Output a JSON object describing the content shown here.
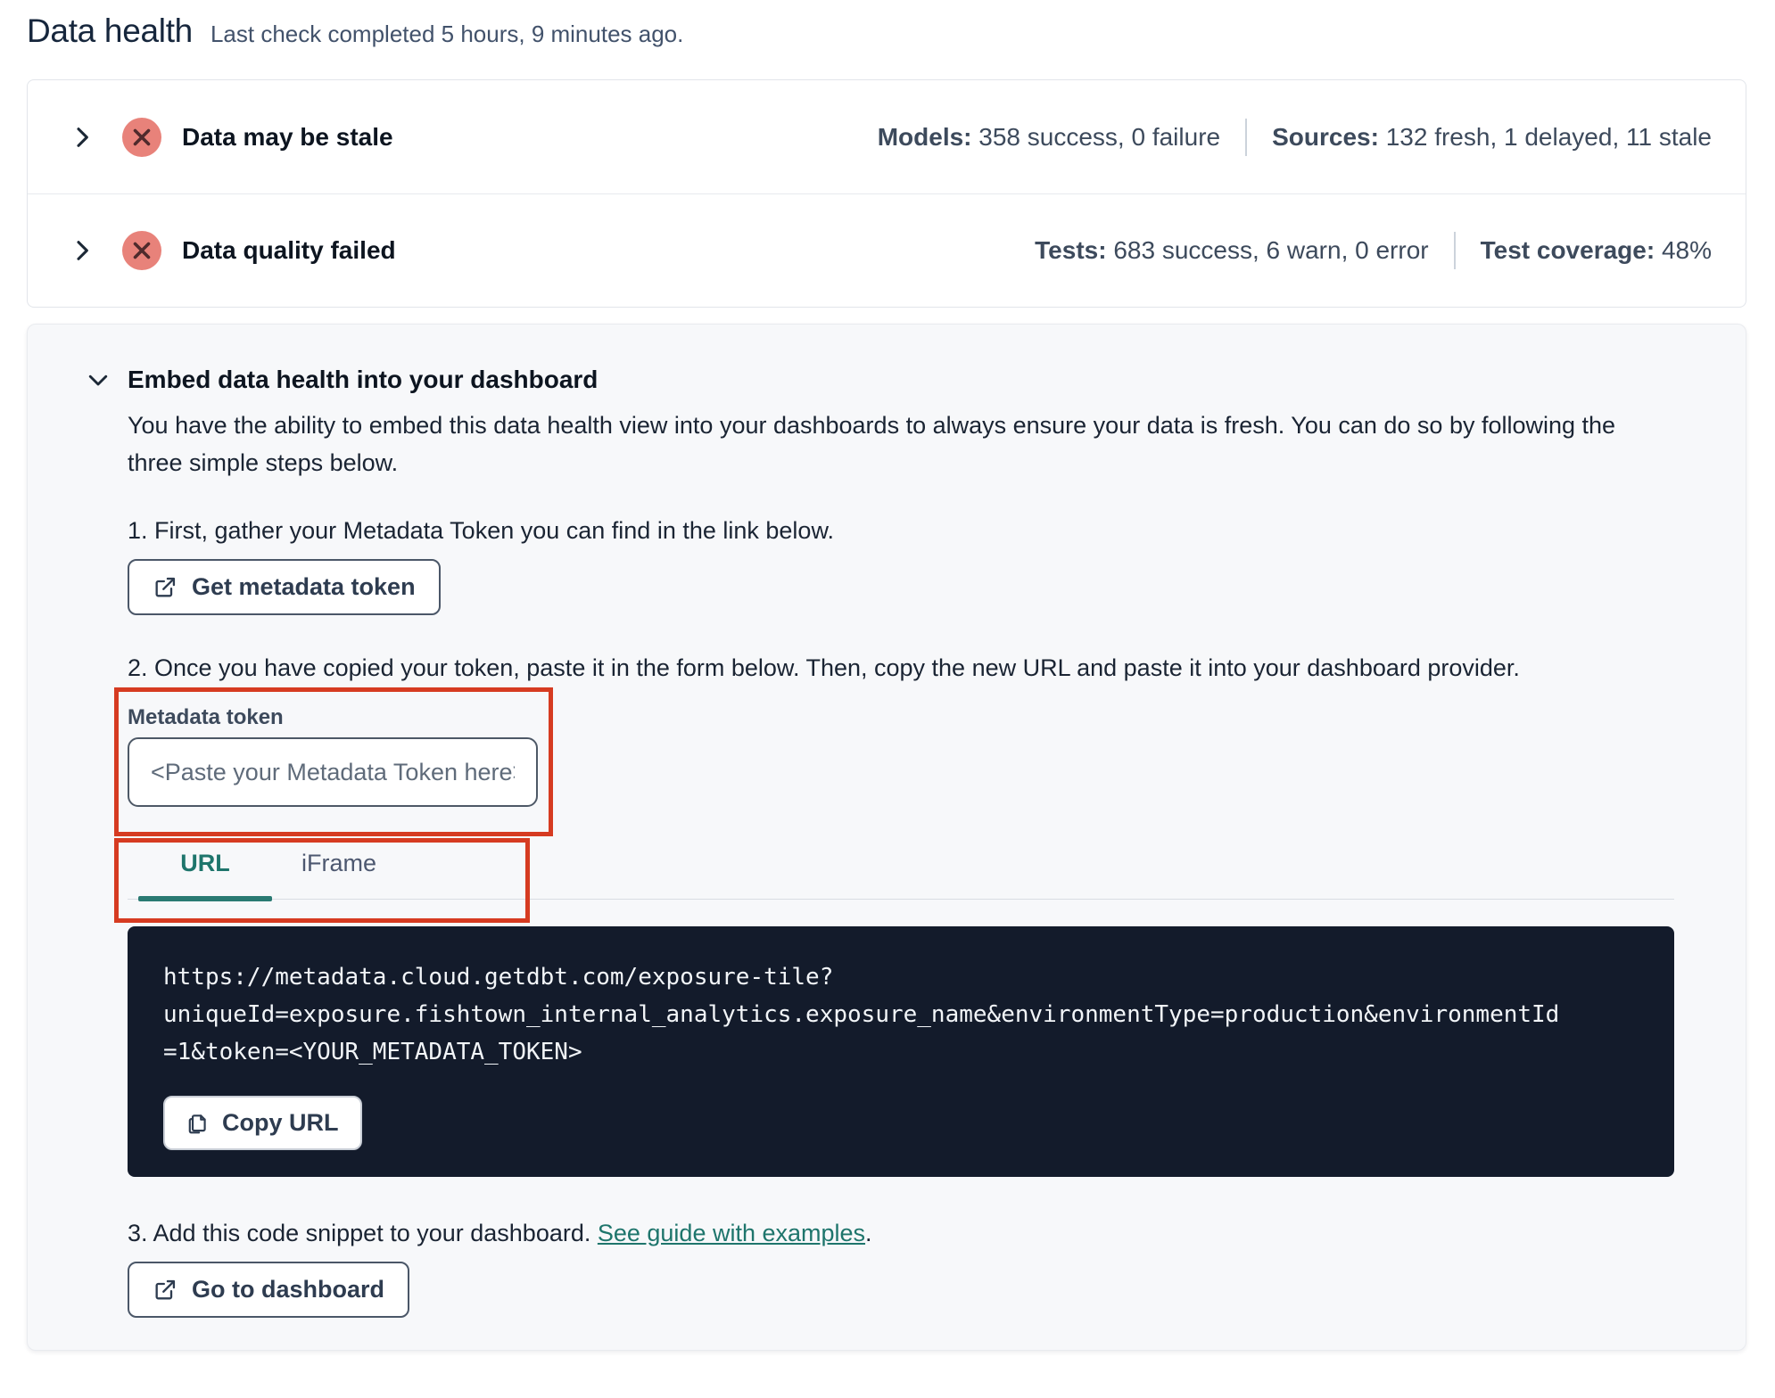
{
  "page": {
    "title": "Data health",
    "subtitle": "Last check completed 5 hours, 9 minutes ago."
  },
  "status_rows": [
    {
      "title": "Data may be stale",
      "status_icon": "error-x-circle",
      "stats": [
        {
          "label": "Models:",
          "value": "358 success, 0 failure"
        },
        {
          "label": "Sources:",
          "value": "132 fresh, 1 delayed, 11 stale"
        }
      ]
    },
    {
      "title": "Data quality failed",
      "status_icon": "error-x-circle",
      "stats": [
        {
          "label": "Tests:",
          "value": "683 success, 6 warn, 0 error"
        },
        {
          "label": "Test coverage:",
          "value": "48%"
        }
      ]
    }
  ],
  "embed": {
    "title": "Embed data health into your dashboard",
    "description": "You have the ability to embed this data health view into your dashboards to always ensure your data is fresh. You can do so by following the three simple steps below.",
    "step1": "1. First, gather your Metadata Token you can find in the link below.",
    "get_token_button": "Get metadata token",
    "step2": "2. Once you have copied your token, paste it in the form below. Then, copy the new URL and paste it into your dashboard provider.",
    "token_label": "Metadata token",
    "token_placeholder": "<Paste your Metadata Token here>",
    "token_value": "",
    "tabs": [
      {
        "label": "URL",
        "active": true
      },
      {
        "label": "iFrame",
        "active": false
      }
    ],
    "code_lines": [
      "https://metadata.cloud.getdbt.com/exposure-tile?",
      "uniqueId=exposure.fishtown_internal_analytics.exposure_name&environmentType=production&environmentId",
      "=1&token=<YOUR_METADATA_TOKEN>"
    ],
    "copy_button": "Copy URL",
    "step3_prefix": "3. Add this code snippet to your dashboard. ",
    "step3_link": "See guide with examples",
    "step3_suffix": ".",
    "dashboard_button": "Go to dashboard"
  },
  "colors": {
    "annotation_red": "#d63b21",
    "teal_accent": "#1e756c",
    "error_icon_fill": "#e8827a",
    "error_icon_glyph": "#4f2a2c",
    "code_background": "#131b2b",
    "embed_card_background": "#f7f8fa",
    "border_grey": "#e2e5ea",
    "text_dark": "#0d1520",
    "text_stats": "#3d4a5c"
  }
}
